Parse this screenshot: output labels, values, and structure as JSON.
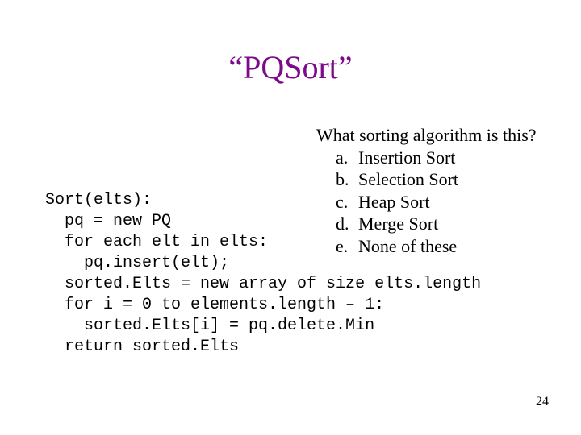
{
  "title": "“PQSort”",
  "question": {
    "prompt": "What sorting algorithm is this?",
    "options": [
      {
        "marker": "a.",
        "label": "Insertion Sort"
      },
      {
        "marker": "b.",
        "label": "Selection Sort"
      },
      {
        "marker": "c.",
        "label": "Heap Sort"
      },
      {
        "marker": "d.",
        "label": "Merge Sort"
      },
      {
        "marker": "e.",
        "label": "None of these"
      }
    ]
  },
  "code": {
    "lines": [
      "Sort(elts):",
      "  pq = new PQ",
      "  for each elt in elts:",
      "    pq.insert(elt);",
      "  sorted.Elts = new array of size elts.length",
      "  for i = 0 to elements.length – 1:",
      "    sorted.Elts[i] = pq.delete.Min",
      "  return sorted.Elts"
    ]
  },
  "page_number": "24"
}
